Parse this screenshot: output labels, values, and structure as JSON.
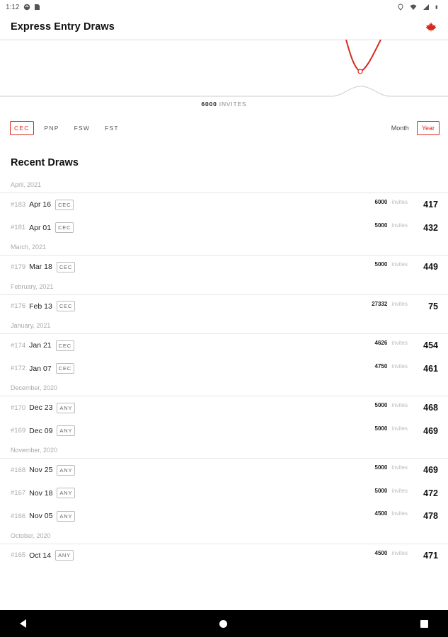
{
  "status_bar": {
    "time": "1:12",
    "left_icons": [
      "sync-icon",
      "sd-card-icon"
    ],
    "right_icons": [
      "location-icon",
      "wifi-icon",
      "signal-icon",
      "battery-icon"
    ]
  },
  "app": {
    "title": "Express Entry Draws",
    "flag_icon": "canada-flag-icon",
    "accent_color": "#d52b1e"
  },
  "chart": {
    "highlight_value": "6000",
    "highlight_label": "INVITES"
  },
  "filters": {
    "programs": [
      {
        "label": "CEC",
        "active": true
      },
      {
        "label": "PNP",
        "active": false
      },
      {
        "label": "FSW",
        "active": false
      },
      {
        "label": "FST",
        "active": false
      }
    ],
    "periods": [
      {
        "label": "Month",
        "active": false
      },
      {
        "label": "Year",
        "active": true
      }
    ]
  },
  "recent": {
    "title": "Recent Draws",
    "invites_label": "invites",
    "groups": [
      {
        "month": "April, 2021",
        "draws": [
          {
            "num": "#183",
            "date": "Apr 16",
            "type": "CEC",
            "invites": "6000",
            "score": "417"
          },
          {
            "num": "#181",
            "date": "Apr 01",
            "type": "CEC",
            "invites": "5000",
            "score": "432"
          }
        ]
      },
      {
        "month": "March, 2021",
        "draws": [
          {
            "num": "#179",
            "date": "Mar 18",
            "type": "CEC",
            "invites": "5000",
            "score": "449"
          }
        ]
      },
      {
        "month": "February, 2021",
        "draws": [
          {
            "num": "#176",
            "date": "Feb 13",
            "type": "CEC",
            "invites": "27332",
            "score": "75"
          }
        ]
      },
      {
        "month": "January, 2021",
        "draws": [
          {
            "num": "#174",
            "date": "Jan 21",
            "type": "CEC",
            "invites": "4626",
            "score": "454"
          },
          {
            "num": "#172",
            "date": "Jan 07",
            "type": "CEC",
            "invites": "4750",
            "score": "461"
          }
        ]
      },
      {
        "month": "December, 2020",
        "draws": [
          {
            "num": "#170",
            "date": "Dec 23",
            "type": "ANY",
            "invites": "5000",
            "score": "468"
          },
          {
            "num": "#169",
            "date": "Dec 09",
            "type": "ANY",
            "invites": "5000",
            "score": "469"
          }
        ]
      },
      {
        "month": "November, 2020",
        "draws": [
          {
            "num": "#168",
            "date": "Nov 25",
            "type": "ANY",
            "invites": "5000",
            "score": "469"
          },
          {
            "num": "#167",
            "date": "Nov 18",
            "type": "ANY",
            "invites": "5000",
            "score": "472"
          },
          {
            "num": "#166",
            "date": "Nov 05",
            "type": "ANY",
            "invites": "4500",
            "score": "478"
          }
        ]
      },
      {
        "month": "October, 2020",
        "draws": [
          {
            "num": "#165",
            "date": "Oct 14",
            "type": "ANY",
            "invites": "4500",
            "score": "471"
          }
        ]
      }
    ]
  },
  "nav": {
    "icons": [
      "back-icon",
      "home-icon",
      "recents-icon"
    ]
  }
}
